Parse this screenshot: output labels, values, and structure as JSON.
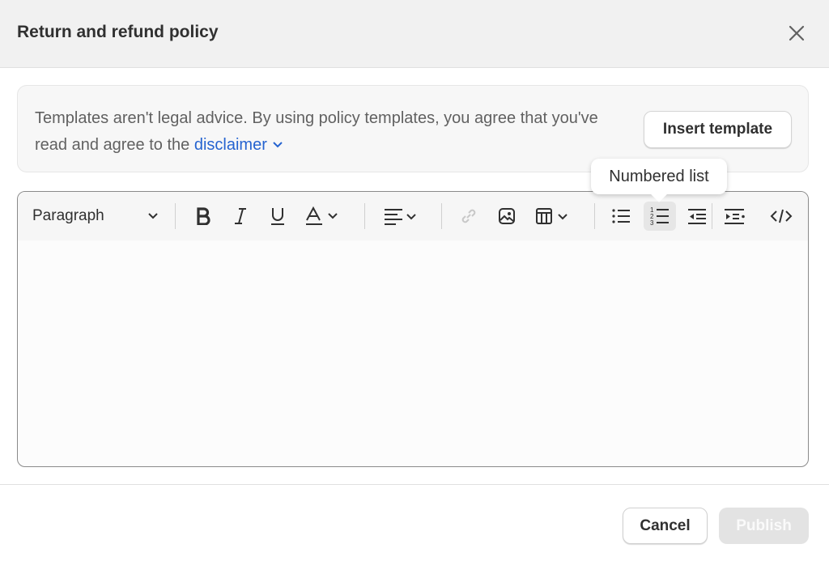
{
  "dialog": {
    "title": "Return and refund policy",
    "close_icon": "close-icon"
  },
  "banner": {
    "text": "Templates aren't legal advice. By using policy templates, you agree that you've read and agree to the ",
    "link": "disclaimer",
    "insert_label": "Insert template"
  },
  "toolbar": {
    "paragraph": "Paragraph",
    "tooltip": "Numbered list",
    "active": "numbered-list"
  },
  "footer": {
    "cancel": "Cancel",
    "publish": "Publish"
  }
}
